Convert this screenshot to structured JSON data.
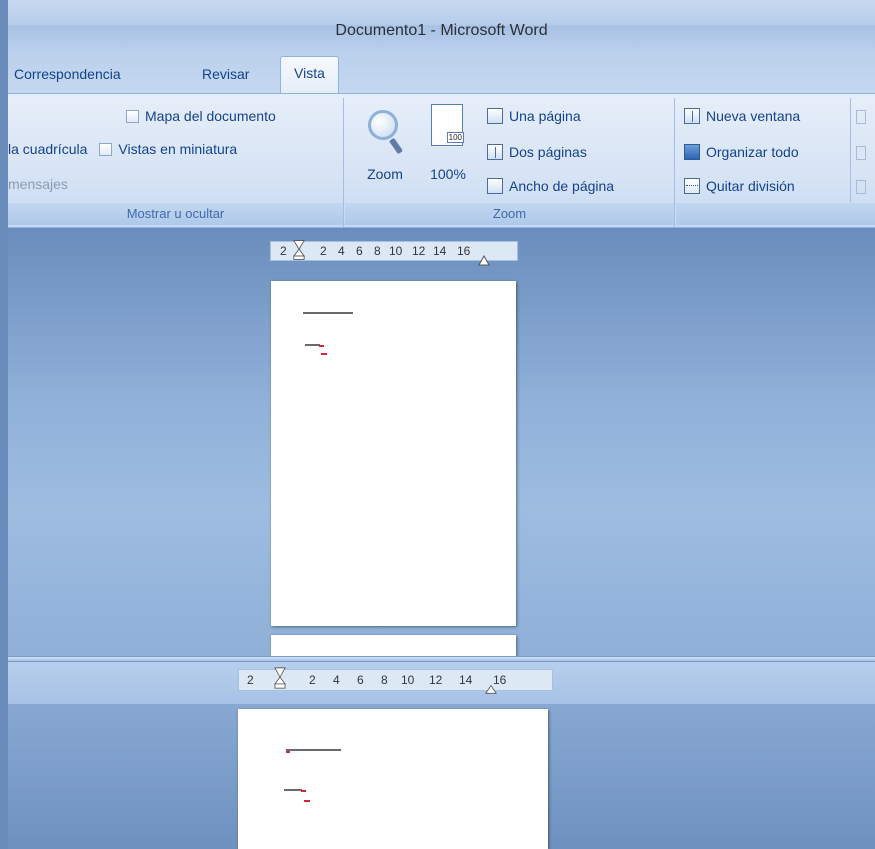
{
  "window": {
    "title": "Documento1 - Microsoft Word"
  },
  "tabs": [
    {
      "label": "Correspondencia",
      "active": false
    },
    {
      "label": "Revisar",
      "active": false
    },
    {
      "label": "Vista",
      "active": true
    }
  ],
  "groups": {
    "mostrar": {
      "label": "Mostrar u ocultar",
      "items": {
        "mapa": "Mapa del documento",
        "cuadricula": "la cuadrícula",
        "miniaturas": "Vistas en miniatura",
        "mensajes": "mensajes"
      }
    },
    "zoom": {
      "label": "Zoom",
      "zoom_button": "Zoom",
      "percent_button": "100%",
      "percent_icon_text": "100",
      "una_pagina": "Una página",
      "dos_paginas": "Dos páginas",
      "ancho_pagina": "Ancho de página"
    },
    "ventana": {
      "nueva_ventana": "Nueva ventana",
      "organizar": "Organizar todo",
      "quitar": "Quitar división"
    }
  },
  "ruler_top": [
    "2",
    "2",
    "4",
    "6",
    "8",
    "10",
    "12",
    "14",
    "16"
  ],
  "ruler_bottom": [
    "2",
    "2",
    "4",
    "6",
    "8",
    "10",
    "12",
    "14",
    "16"
  ],
  "colors": {
    "accent": "#15428b",
    "ribbon": "#d7e4f5",
    "doc_bg": "#90b1d9"
  }
}
